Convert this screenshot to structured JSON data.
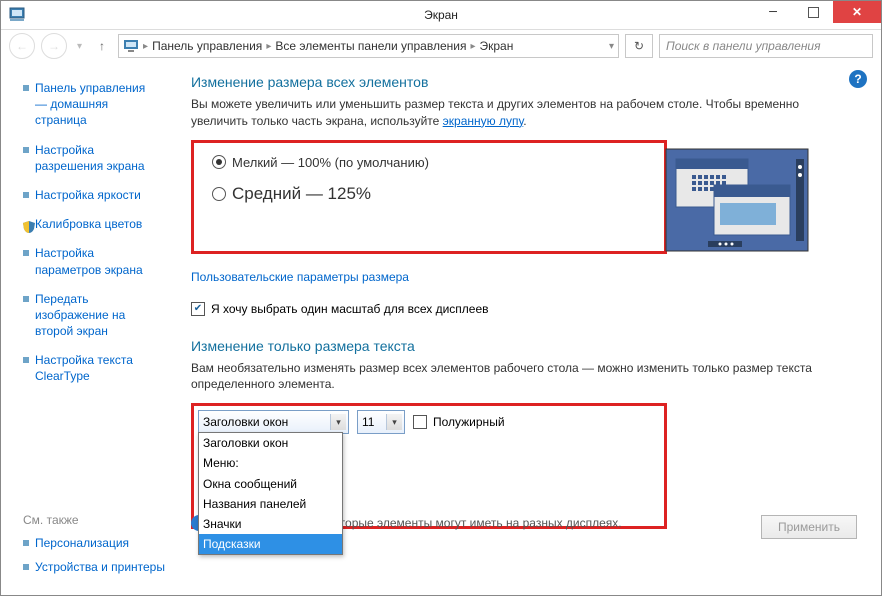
{
  "titlebar": {
    "title": "Экран"
  },
  "nav": {
    "path": [
      "Панель управления",
      "Все элементы панели управления",
      "Экран"
    ],
    "search_placeholder": "Поиск в панели управления"
  },
  "sidebar": {
    "items": [
      "Панель управления — домашняя страница",
      "Настройка разрешения экрана",
      "Настройка яркости",
      "Калибровка цветов",
      "Настройка параметров экрана",
      "Передать изображение на второй экран",
      "Настройка текста ClearType"
    ],
    "see_also": {
      "heading": "См. также",
      "items": [
        "Персонализация",
        "Устройства и принтеры"
      ]
    }
  },
  "main": {
    "heading1": "Изменение размера всех элементов",
    "para1a": "Вы можете увеличить или уменьшить размер текста и других элементов на рабочем столе. Чтобы временно увеличить только часть экрана, используйте ",
    "para1_link": "экранную лупу",
    "radios": {
      "small": "Мелкий — 100% (по умолчанию)",
      "medium": "Средний — 125%"
    },
    "custom_link": "Пользовательские параметры размера",
    "cb_label": "Я хочу выбрать один масштаб для всех дисплеев",
    "heading2": "Изменение только размера текста",
    "para2": "Вам необязательно изменять размер всех элементов рабочего стола — можно изменить только размер текста определенного элемента.",
    "select1_value": "Заголовки окон",
    "select1_options": [
      "Заголовки окон",
      "Меню:",
      "Окна сообщений",
      "Названия панелей",
      "Значки",
      "Подсказки"
    ],
    "select2_value": "11",
    "bold_label": "Полужирный",
    "note": "те один масштаб, некоторые элементы могут иметь на разных дисплеях.",
    "apply": "Применить"
  }
}
